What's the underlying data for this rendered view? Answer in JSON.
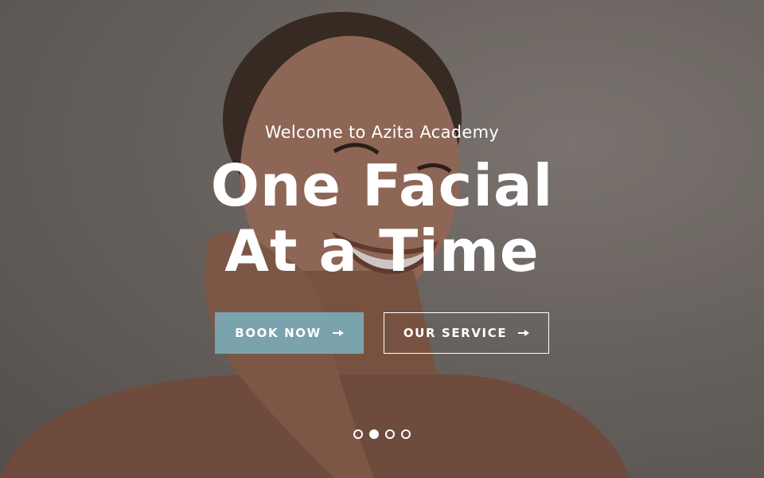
{
  "hero": {
    "eyebrow": "Welcome to Azita Academy",
    "headline_line1": "One Facial",
    "headline_line2": "At a Time",
    "accent_color": "#7ba3ad"
  },
  "buttons": {
    "book_now": "BOOK NOW",
    "our_service": "OUR SERVICE"
  },
  "slider": {
    "total_slides": 4,
    "active_slide": 2
  }
}
